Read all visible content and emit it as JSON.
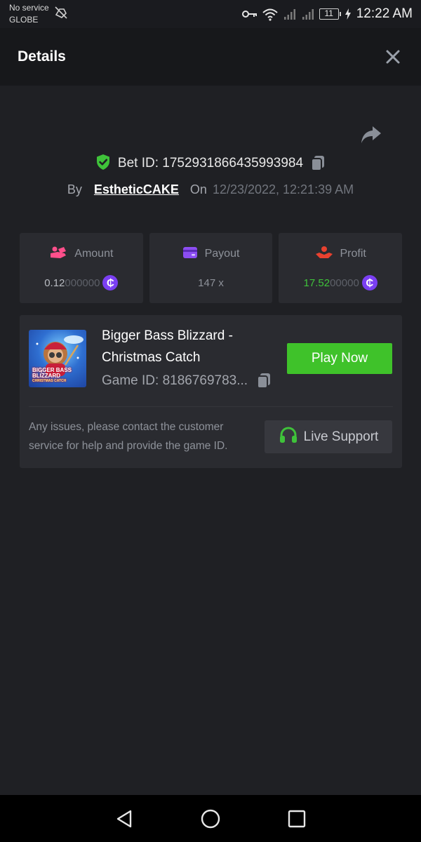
{
  "status_bar": {
    "carrier_line1": "No service",
    "carrier_line2": "GLOBE",
    "battery": "11",
    "time": "12:22 AM"
  },
  "header": {
    "title": "Details",
    "close_icon": "close-icon"
  },
  "bet": {
    "id_text": "Bet ID: 1752931866435993984",
    "by_label": "By",
    "username": "EstheticCAKE",
    "on_label": "On",
    "date": "12/23/2022, 12:21:39 AM"
  },
  "stats": {
    "amount": {
      "label": "Amount",
      "value_main": "0.12",
      "value_dim": "000000",
      "coin": "₵"
    },
    "payout": {
      "label": "Payout",
      "value": "147 x"
    },
    "profit": {
      "label": "Profit",
      "value_main": "17.52",
      "value_dim": "00000",
      "coin": "₵"
    }
  },
  "game": {
    "title": "Bigger Bass Blizzard - Christmas Catch",
    "thumb_title": "BIGGER BASS BLIZZARD",
    "thumb_subtitle": "CHRISTMAS CATCH",
    "game_id": "Game ID: 8186769783...",
    "play_label": "Play Now",
    "issues_text": "Any issues, please contact the customer service for help and provide the game ID.",
    "support_label": "Live Support"
  },
  "colors": {
    "background": "#1f2024",
    "card": "#2a2b30",
    "accent_green": "#3fc22a",
    "coin_purple": "#7b3ff2",
    "shield_green": "#3fc23a"
  }
}
